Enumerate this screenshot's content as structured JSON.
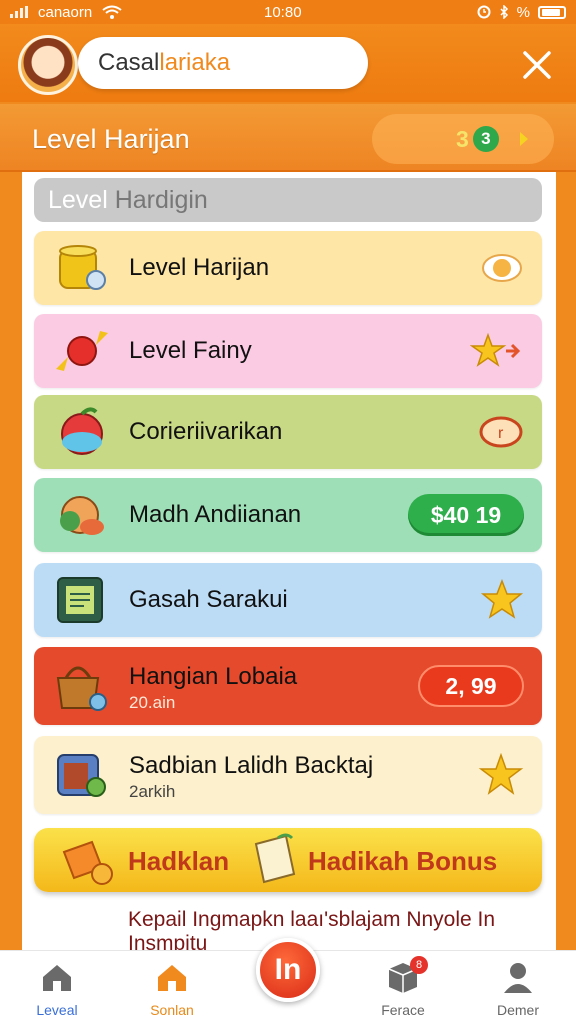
{
  "status": {
    "carrier": "canaorn",
    "time": "10:80",
    "right": "%"
  },
  "header": {
    "search_text_main": "Casal ",
    "search_text_accent": "lariaka"
  },
  "level_bar": {
    "title": "Level Harijan",
    "counter": "3",
    "badge": "3"
  },
  "section": {
    "title_light": "Level ",
    "title_dim": "Hardigin"
  },
  "rows": [
    {
      "title": "Level Harijan",
      "sub": "",
      "bg": "#fde6a6",
      "right": "coin"
    },
    {
      "title": "Level Fainy",
      "sub": "",
      "bg": "#fbcbe3",
      "right": "star-arrow"
    },
    {
      "title": "Corieriivarikan",
      "sub": "",
      "bg": "#c7d985",
      "right": "coin-red"
    },
    {
      "title": "Madh Andiianan",
      "sub": "",
      "bg": "#9edfb7",
      "right": "price",
      "price": "$40 19",
      "price_color": "#2fae4c"
    },
    {
      "title": "Gasah Sarakui",
      "sub": "",
      "bg": "#bcdcf6",
      "right": "star"
    },
    {
      "title": "Hangian Lobaia",
      "sub": "20.ain",
      "bg": "#e44a2b",
      "right": "price",
      "price": "2, 99",
      "price_color": "#e5321f"
    },
    {
      "title": "Sadbian Lalidh Backtaj",
      "sub": "2arkih",
      "bg": "#fdf0cc",
      "right": "star"
    }
  ],
  "bonus": {
    "label_left": "Hadklan",
    "label_right": "Hadikah Bonus"
  },
  "description": "Kepail Ingmapkn laaı'sblajam Nnyole In Insmpitu",
  "nav": {
    "items": [
      {
        "label": "Leveal",
        "color": "#3a6fd8"
      },
      {
        "label": "Sonlan",
        "color": "#e88a1a"
      },
      {
        "label": "Ferace",
        "color": "#666666"
      },
      {
        "label": "Demer",
        "color": "#666666"
      }
    ],
    "center": "In",
    "badge": "8"
  }
}
